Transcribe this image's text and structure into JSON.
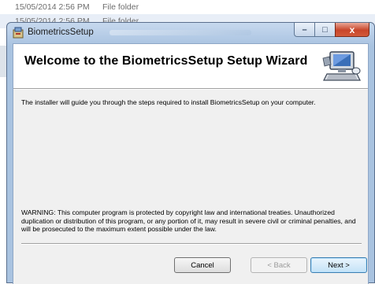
{
  "background": {
    "rows": [
      {
        "date": "15/05/2014 2:56 PM",
        "type": "File folder"
      },
      {
        "date": "15/05/2014 2:56 PM",
        "type": "File folder"
      }
    ]
  },
  "window": {
    "title": "BiometricsSetup",
    "controls": {
      "minimize": "–",
      "maximize": "□",
      "close": "x"
    }
  },
  "banner": {
    "title": "Welcome to the BiometricsSetup Setup Wizard"
  },
  "body": {
    "intro": "The installer will guide you through the steps required to install BiometricsSetup on your computer.",
    "warning": "WARNING: This computer program is protected by copyright law and international treaties. Unauthorized duplication or distribution of this program, or any portion of it, may result in severe civil or criminal penalties, and will be prosecuted to the maximum extent possible under the law."
  },
  "buttons": {
    "cancel": "Cancel",
    "back": "< Back",
    "next": "Next >"
  },
  "colors": {
    "title_bar": "#b4cbe6",
    "close_button": "#c8452a",
    "default_button_border": "#3c7fb1"
  }
}
